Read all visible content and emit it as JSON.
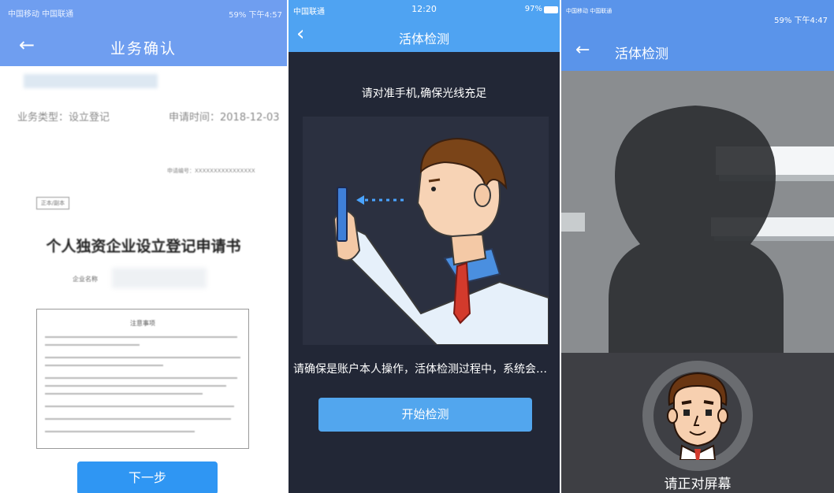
{
  "panel1": {
    "status_left": "中国移动 中国联通",
    "status_right": "59% 下午4:57",
    "title": "业务确认",
    "business_type": "业务类型：设立登记",
    "apply_time": "申请时间：2018-12-03",
    "doc_number": "申请编号：XXXXXXXXXXXXXXXX",
    "stamp_text": "正本/副本",
    "doc_title": "个人独资企业设立登记申请书",
    "enterprise_label": "企业名称",
    "notice_title": "注意事项",
    "next_button": "下一步"
  },
  "panel2": {
    "carrier": "中国联通",
    "time": "12:20",
    "battery": "97%",
    "title": "活体检测",
    "instruction": "请对准手机,确保光线充足",
    "confirm_text": "请确保是账户本人操作，活体检测过程中，系统会…",
    "start_button": "开始检测"
  },
  "panel3": {
    "status_left": "中国移动 中国联通",
    "status_right": "59% 下午4:47",
    "title": "活体检测",
    "prompt": "请正对屏幕"
  },
  "icons": [
    "back-arrow-icon",
    "wifi-icon",
    "battery-icon",
    "signal-icon"
  ],
  "colors": {
    "nav_blue_1": "#6f9ef0",
    "nav_blue_2": "#4fa3f2",
    "nav_blue_3": "#5a94ea",
    "button_blue": "#2f96f3",
    "dark_bg": "#222736"
  }
}
